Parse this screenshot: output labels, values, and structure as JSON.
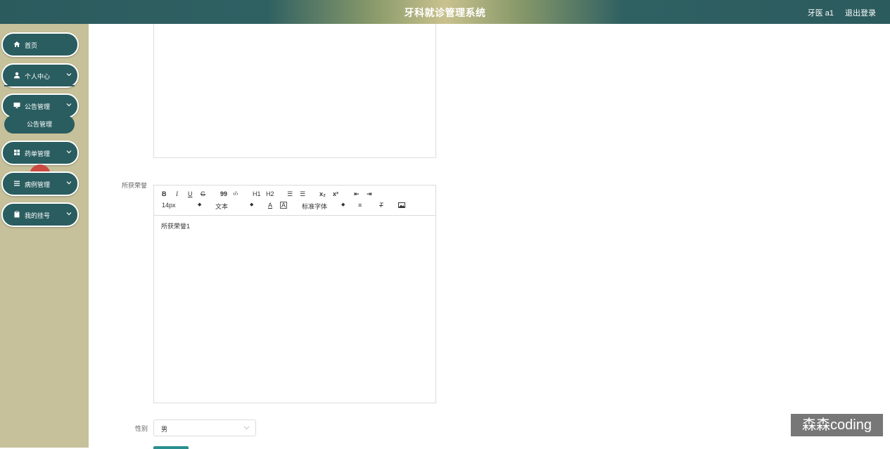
{
  "header": {
    "title": "牙科就诊管理系统",
    "user": "牙医 a1",
    "logout": "退出登录"
  },
  "sidebar": {
    "items": [
      {
        "label": "首页",
        "icon": "home-icon"
      },
      {
        "label": "个人中心",
        "icon": "user-icon"
      },
      {
        "label": "公告管理",
        "icon": "monitor-icon"
      },
      {
        "label": "药单管理",
        "icon": "grid-icon"
      },
      {
        "label": "病例管理",
        "icon": "list-icon"
      },
      {
        "label": "我的挂号",
        "icon": "clipboard-icon"
      }
    ],
    "submenu": {
      "label": "公告管理"
    }
  },
  "form": {
    "honor_label": "所获荣誉",
    "toolbar": {
      "bold": "B",
      "italic": "I",
      "underline": "U",
      "strike": "G",
      "quote": "99",
      "code": "‹/›",
      "h1": "H1",
      "h2": "H2",
      "ordered_list": "☰",
      "bullet_list": "☰",
      "sub": "x₂",
      "sup": "x²",
      "indent_left": "⇤",
      "indent_right": "⇥",
      "size_select": "14px",
      "header_select": "文本",
      "font_select": "标准字体",
      "color": "A",
      "bg_color": "A",
      "align": "≡",
      "clean": "T"
    },
    "honor_value": "所获荣誉1",
    "gender_label": "性别",
    "gender_value": "男"
  },
  "watermark": "森森coding",
  "colors": {
    "accent": "#2a5d60",
    "sidebar_bg": "#c6c19a",
    "cursor": "#cd2d2d"
  }
}
